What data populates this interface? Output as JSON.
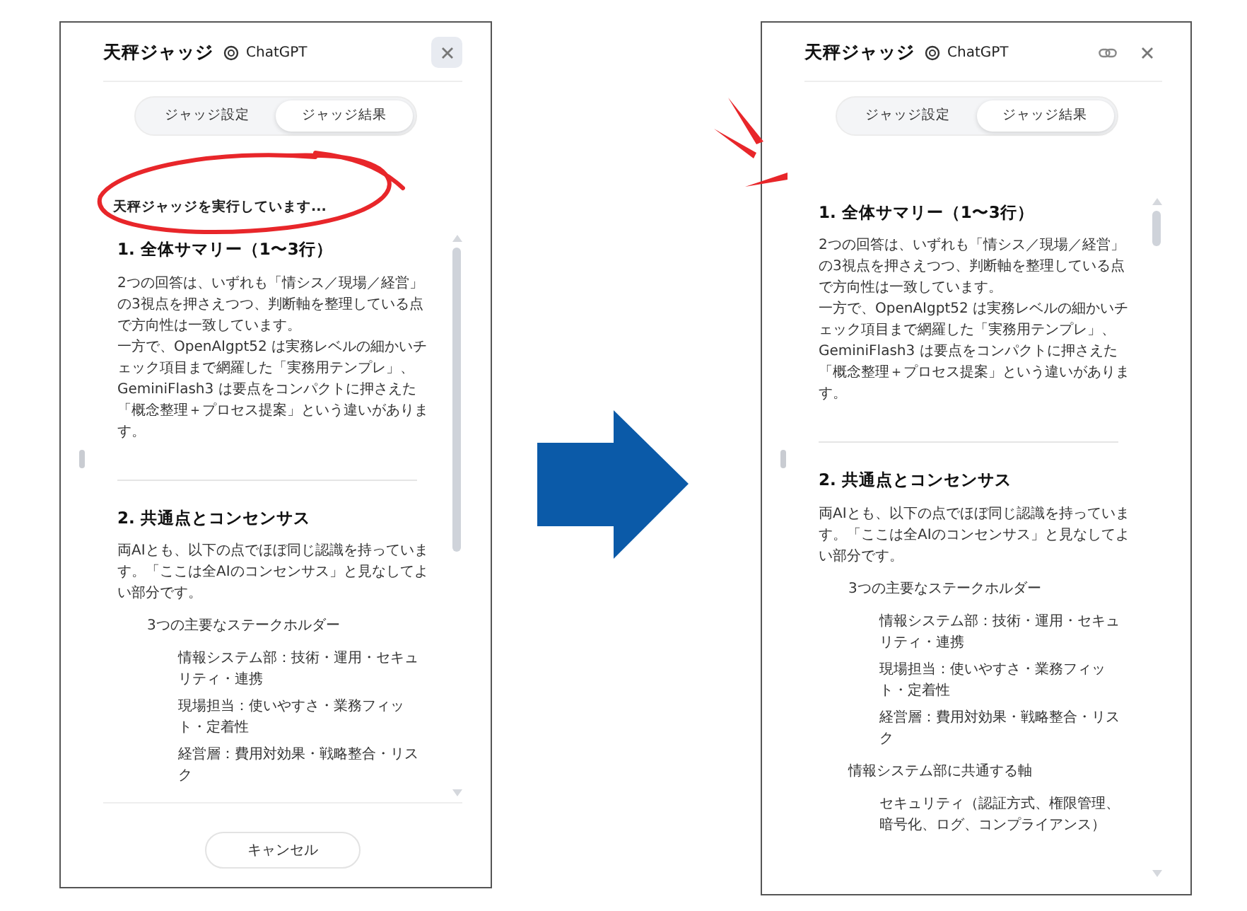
{
  "panels": [
    {
      "circled": true,
      "emphasized": false,
      "title": "天秤ジャッジ",
      "brand": "ChatGPT",
      "header_buttons": [
        {
          "kind": "close",
          "highlighted": true
        }
      ],
      "tabs": [
        {
          "label": "ジャッジ設定",
          "selected": false
        },
        {
          "label": "ジャッジ結果",
          "selected": true
        }
      ],
      "status": "天秤ジャッジを実行しています...",
      "sections": [
        {
          "heading": "1. 全体サマリー（1〜3行）",
          "paragraphs": [
            "2つの回答は、いずれも「情シス／現場／経営」の3視点を押さえつつ、判断軸を整理している点で方向性は一致しています。",
            "一方で、OpenAIgpt52 は実務レベルの細かいチェック項目まで網羅した「実務用テンプレ」、GeminiFlash3 は要点をコンパクトに押さえた「概念整理＋プロセス提案」という違いがあります。"
          ]
        },
        {
          "heading": "2. 共通点とコンセンサス",
          "paragraphs": [
            "両AIとも、以下の点でほぼ同じ認識を持っています。「ここは全AIのコンセンサス」と見なしてよい部分です。"
          ],
          "list": [
            {
              "text": "3つの主要なステークホルダー",
              "children": [
                {
                  "text": "情報システム部：技術・運用・セキュリティ・連携"
                },
                {
                  "text": "現場担当：使いやすさ・業務フィット・定着性"
                },
                {
                  "text": "経営層：費用対効果・戦略整合・リスク"
                }
              ]
            }
          ]
        }
      ],
      "footer_button": "キャンセル"
    },
    {
      "circled": false,
      "emphasized": true,
      "title": "天秤ジャッジ",
      "brand": "ChatGPT",
      "header_buttons": [
        {
          "kind": "link",
          "highlighted": false
        },
        {
          "kind": "close",
          "highlighted": false
        }
      ],
      "tabs": [
        {
          "label": "ジャッジ設定",
          "selected": false
        },
        {
          "label": "ジャッジ結果",
          "selected": true
        }
      ],
      "sections": [
        {
          "heading": "1. 全体サマリー（1〜3行）",
          "paragraphs": [
            "2つの回答は、いずれも「情シス／現場／経営」の3視点を押さえつつ、判断軸を整理している点で方向性は一致しています。",
            "一方で、OpenAIgpt52 は実務レベルの細かいチェック項目まで網羅した「実務用テンプレ」、GeminiFlash3 は要点をコンパクトに押さえた「概念整理＋プロセス提案」という違いがあります。"
          ]
        },
        {
          "heading": "2. 共通点とコンセンサス",
          "paragraphs": [
            "両AIとも、以下の点でほぼ同じ認識を持っています。「ここは全AIのコンセンサス」と見なしてよい部分です。"
          ],
          "list": [
            {
              "text": "3つの主要なステークホルダー",
              "children": [
                {
                  "text": "情報システム部：技術・運用・セキュリティ・連携"
                },
                {
                  "text": "現場担当：使いやすさ・業務フィット・定着性"
                },
                {
                  "text": "経営層：費用対効果・戦略整合・リスク"
                }
              ]
            },
            {
              "text": "情報システム部に共通する軸",
              "children": [
                {
                  "text": "セキュリティ（認証方式、権限管理、暗号化、ログ、コンプライアンス）"
                }
              ]
            }
          ]
        }
      ]
    }
  ]
}
